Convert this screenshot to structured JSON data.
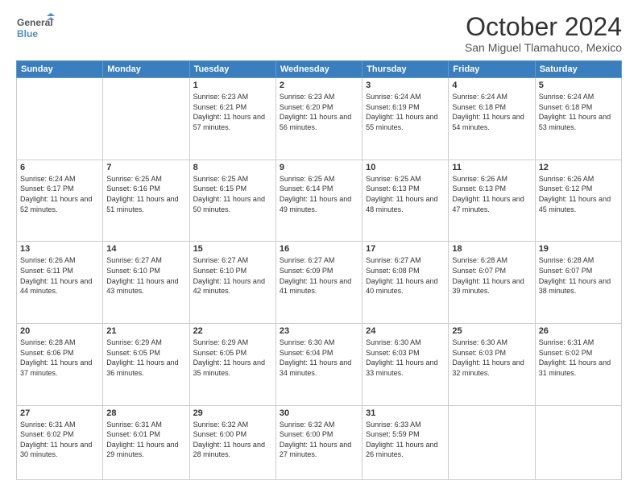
{
  "header": {
    "logo_line1": "General",
    "logo_line2": "Blue",
    "title": "October 2024",
    "subtitle": "San Miguel Tlamahuco, Mexico"
  },
  "weekdays": [
    "Sunday",
    "Monday",
    "Tuesday",
    "Wednesday",
    "Thursday",
    "Friday",
    "Saturday"
  ],
  "weeks": [
    [
      {
        "day": "",
        "sunrise": "",
        "sunset": "",
        "daylight": ""
      },
      {
        "day": "",
        "sunrise": "",
        "sunset": "",
        "daylight": ""
      },
      {
        "day": "1",
        "sunrise": "Sunrise: 6:23 AM",
        "sunset": "Sunset: 6:21 PM",
        "daylight": "Daylight: 11 hours and 57 minutes."
      },
      {
        "day": "2",
        "sunrise": "Sunrise: 6:23 AM",
        "sunset": "Sunset: 6:20 PM",
        "daylight": "Daylight: 11 hours and 56 minutes."
      },
      {
        "day": "3",
        "sunrise": "Sunrise: 6:24 AM",
        "sunset": "Sunset: 6:19 PM",
        "daylight": "Daylight: 11 hours and 55 minutes."
      },
      {
        "day": "4",
        "sunrise": "Sunrise: 6:24 AM",
        "sunset": "Sunset: 6:18 PM",
        "daylight": "Daylight: 11 hours and 54 minutes."
      },
      {
        "day": "5",
        "sunrise": "Sunrise: 6:24 AM",
        "sunset": "Sunset: 6:18 PM",
        "daylight": "Daylight: 11 hours and 53 minutes."
      }
    ],
    [
      {
        "day": "6",
        "sunrise": "Sunrise: 6:24 AM",
        "sunset": "Sunset: 6:17 PM",
        "daylight": "Daylight: 11 hours and 52 minutes."
      },
      {
        "day": "7",
        "sunrise": "Sunrise: 6:25 AM",
        "sunset": "Sunset: 6:16 PM",
        "daylight": "Daylight: 11 hours and 51 minutes."
      },
      {
        "day": "8",
        "sunrise": "Sunrise: 6:25 AM",
        "sunset": "Sunset: 6:15 PM",
        "daylight": "Daylight: 11 hours and 50 minutes."
      },
      {
        "day": "9",
        "sunrise": "Sunrise: 6:25 AM",
        "sunset": "Sunset: 6:14 PM",
        "daylight": "Daylight: 11 hours and 49 minutes."
      },
      {
        "day": "10",
        "sunrise": "Sunrise: 6:25 AM",
        "sunset": "Sunset: 6:13 PM",
        "daylight": "Daylight: 11 hours and 48 minutes."
      },
      {
        "day": "11",
        "sunrise": "Sunrise: 6:26 AM",
        "sunset": "Sunset: 6:13 PM",
        "daylight": "Daylight: 11 hours and 47 minutes."
      },
      {
        "day": "12",
        "sunrise": "Sunrise: 6:26 AM",
        "sunset": "Sunset: 6:12 PM",
        "daylight": "Daylight: 11 hours and 45 minutes."
      }
    ],
    [
      {
        "day": "13",
        "sunrise": "Sunrise: 6:26 AM",
        "sunset": "Sunset: 6:11 PM",
        "daylight": "Daylight: 11 hours and 44 minutes."
      },
      {
        "day": "14",
        "sunrise": "Sunrise: 6:27 AM",
        "sunset": "Sunset: 6:10 PM",
        "daylight": "Daylight: 11 hours and 43 minutes."
      },
      {
        "day": "15",
        "sunrise": "Sunrise: 6:27 AM",
        "sunset": "Sunset: 6:10 PM",
        "daylight": "Daylight: 11 hours and 42 minutes."
      },
      {
        "day": "16",
        "sunrise": "Sunrise: 6:27 AM",
        "sunset": "Sunset: 6:09 PM",
        "daylight": "Daylight: 11 hours and 41 minutes."
      },
      {
        "day": "17",
        "sunrise": "Sunrise: 6:27 AM",
        "sunset": "Sunset: 6:08 PM",
        "daylight": "Daylight: 11 hours and 40 minutes."
      },
      {
        "day": "18",
        "sunrise": "Sunrise: 6:28 AM",
        "sunset": "Sunset: 6:07 PM",
        "daylight": "Daylight: 11 hours and 39 minutes."
      },
      {
        "day": "19",
        "sunrise": "Sunrise: 6:28 AM",
        "sunset": "Sunset: 6:07 PM",
        "daylight": "Daylight: 11 hours and 38 minutes."
      }
    ],
    [
      {
        "day": "20",
        "sunrise": "Sunrise: 6:28 AM",
        "sunset": "Sunset: 6:06 PM",
        "daylight": "Daylight: 11 hours and 37 minutes."
      },
      {
        "day": "21",
        "sunrise": "Sunrise: 6:29 AM",
        "sunset": "Sunset: 6:05 PM",
        "daylight": "Daylight: 11 hours and 36 minutes."
      },
      {
        "day": "22",
        "sunrise": "Sunrise: 6:29 AM",
        "sunset": "Sunset: 6:05 PM",
        "daylight": "Daylight: 11 hours and 35 minutes."
      },
      {
        "day": "23",
        "sunrise": "Sunrise: 6:30 AM",
        "sunset": "Sunset: 6:04 PM",
        "daylight": "Daylight: 11 hours and 34 minutes."
      },
      {
        "day": "24",
        "sunrise": "Sunrise: 6:30 AM",
        "sunset": "Sunset: 6:03 PM",
        "daylight": "Daylight: 11 hours and 33 minutes."
      },
      {
        "day": "25",
        "sunrise": "Sunrise: 6:30 AM",
        "sunset": "Sunset: 6:03 PM",
        "daylight": "Daylight: 11 hours and 32 minutes."
      },
      {
        "day": "26",
        "sunrise": "Sunrise: 6:31 AM",
        "sunset": "Sunset: 6:02 PM",
        "daylight": "Daylight: 11 hours and 31 minutes."
      }
    ],
    [
      {
        "day": "27",
        "sunrise": "Sunrise: 6:31 AM",
        "sunset": "Sunset: 6:02 PM",
        "daylight": "Daylight: 11 hours and 30 minutes."
      },
      {
        "day": "28",
        "sunrise": "Sunrise: 6:31 AM",
        "sunset": "Sunset: 6:01 PM",
        "daylight": "Daylight: 11 hours and 29 minutes."
      },
      {
        "day": "29",
        "sunrise": "Sunrise: 6:32 AM",
        "sunset": "Sunset: 6:00 PM",
        "daylight": "Daylight: 11 hours and 28 minutes."
      },
      {
        "day": "30",
        "sunrise": "Sunrise: 6:32 AM",
        "sunset": "Sunset: 6:00 PM",
        "daylight": "Daylight: 11 hours and 27 minutes."
      },
      {
        "day": "31",
        "sunrise": "Sunrise: 6:33 AM",
        "sunset": "Sunset: 5:59 PM",
        "daylight": "Daylight: 11 hours and 26 minutes."
      },
      {
        "day": "",
        "sunrise": "",
        "sunset": "",
        "daylight": ""
      },
      {
        "day": "",
        "sunrise": "",
        "sunset": "",
        "daylight": ""
      }
    ]
  ]
}
